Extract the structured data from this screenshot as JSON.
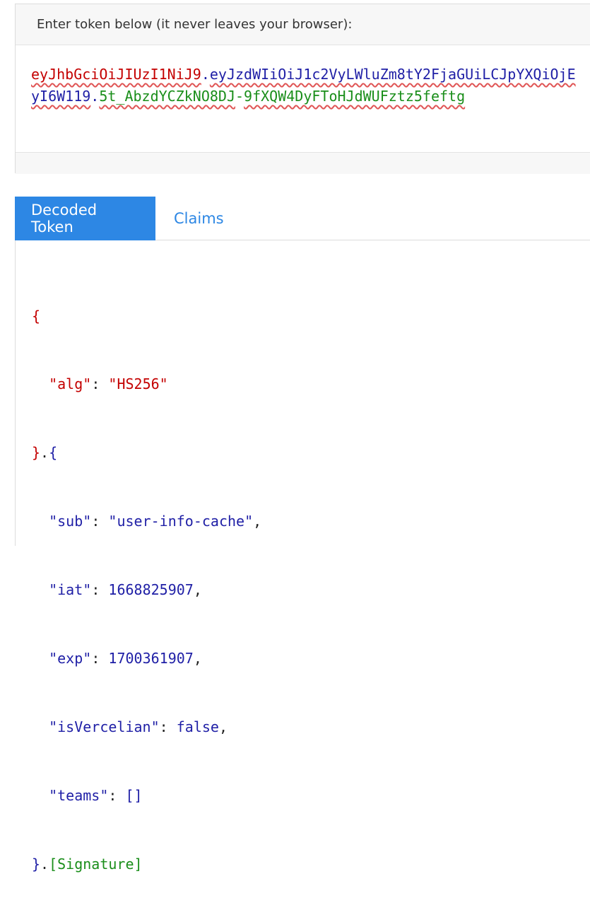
{
  "token_input": {
    "prompt": "Enter token below (it never leaves your browser):",
    "line1": {
      "header_segment": "eyJhbGciOiJIUzI1NiJ9",
      "payload_segment_start": "eyJzdWIiOiJ1c2VyLWluZm8tY2FjaGUiLCJpYXQiOjE"
    },
    "line2": {
      "payload_segment_end": "yI6W119",
      "signature_part1": "5t_AbzdYCZkNO8DJ",
      "signature_part2": "9fXQW4DyFToHJdWUFztz5feftg"
    }
  },
  "tabs": {
    "decoded": "Decoded Token",
    "claims": "Claims"
  },
  "decoded": {
    "header": {
      "alg_key": "\"alg\"",
      "alg_value": "\"HS256\""
    },
    "payload": {
      "sub_key": "\"sub\"",
      "sub_value": "\"user-info-cache\"",
      "iat_key": "\"iat\"",
      "iat_value": "1668825907",
      "exp_key": "\"exp\"",
      "exp_value": "1700361907",
      "isVercelian_key": "\"isVercelian\"",
      "isVercelian_value": "false",
      "teams_key": "\"teams\"",
      "teams_value": "[]"
    },
    "signature_label": "[Signature]"
  },
  "colors": {
    "header": "#c40000",
    "payload": "#1f1fa6",
    "signature": "#1a8e1a",
    "accent": "#2d87e4"
  }
}
